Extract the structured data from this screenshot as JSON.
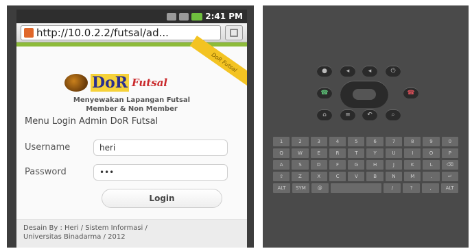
{
  "statusbar": {
    "time": "2:41 PM"
  },
  "browser": {
    "url": "http://10.0.2.2/futsal/ad..."
  },
  "ribbon": {
    "text": "DoR Futsal"
  },
  "logo": {
    "brand": "DoR",
    "brand_suffix": "Futsal"
  },
  "tagline": {
    "line1": "Menyewakan Lapangan Futsal",
    "line2": "Member & Non Member"
  },
  "login": {
    "title": "Menu Login Admin DoR Futsal",
    "username_label": "Username",
    "username_value": "heri",
    "password_label": "Password",
    "password_value": "•••",
    "button_label": "Login"
  },
  "footer": {
    "line1": "Desain By : Heri / Sistem Informasi /",
    "line2": "Universitas Binadarma / 2012"
  },
  "keyboard": {
    "rows": [
      [
        "1",
        "2",
        "3",
        "4",
        "5",
        "6",
        "7",
        "8",
        "9",
        "0"
      ],
      [
        "Q",
        "W",
        "E",
        "R",
        "T",
        "Y",
        "U",
        "I",
        "O",
        "P"
      ],
      [
        "A",
        "S",
        "D",
        "F",
        "G",
        "H",
        "J",
        "K",
        "L",
        "⌫"
      ],
      [
        "⇧",
        "Z",
        "X",
        "C",
        "V",
        "B",
        "N",
        "M",
        ".",
        "↵"
      ]
    ],
    "bottom": [
      "ALT",
      "SYM",
      "@",
      "",
      "/",
      "?",
      ",",
      "ALT"
    ]
  },
  "colors": {
    "accent_green": "#8dbb3a",
    "ribbon_yellow": "#f3c322",
    "brand_blue": "#2a2f8f",
    "brand_red": "#c9282a"
  }
}
